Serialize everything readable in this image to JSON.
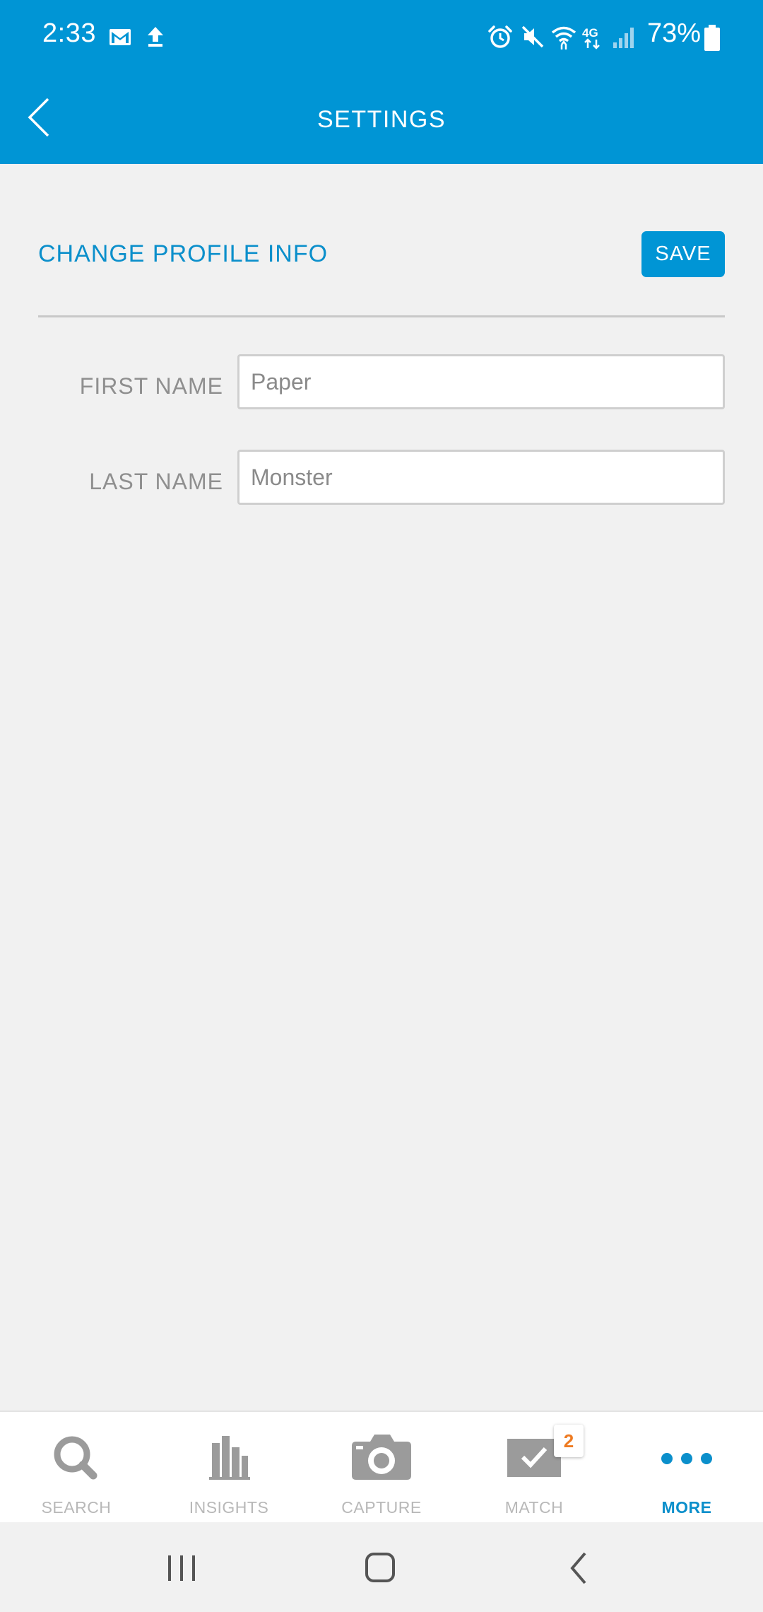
{
  "status_bar": {
    "time": "2:33",
    "battery_percent": "73%",
    "icons": [
      "gmail-icon",
      "upload-icon",
      "alarm-icon",
      "mute-icon",
      "wifi-icon",
      "4g-lte-icon",
      "signal-icon",
      "battery-icon"
    ]
  },
  "header": {
    "title": "SETTINGS",
    "back_icon": "chevron-left-icon"
  },
  "profile": {
    "section_title": "CHANGE PROFILE INFO",
    "save_label": "SAVE",
    "first_name_label": "FIRST NAME",
    "first_name_value": "Paper",
    "last_name_label": "LAST NAME",
    "last_name_value": "Monster"
  },
  "bottom_nav": {
    "tabs": [
      {
        "label": "SEARCH",
        "icon": "search-icon",
        "active": false
      },
      {
        "label": "INSIGHTS",
        "icon": "bar-chart-icon",
        "active": false
      },
      {
        "label": "CAPTURE",
        "icon": "camera-icon",
        "active": false
      },
      {
        "label": "MATCH",
        "icon": "check-box-icon",
        "active": false,
        "badge": "2"
      },
      {
        "label": "MORE",
        "icon": "more-dots-icon",
        "active": true
      }
    ]
  },
  "system_nav": {
    "buttons": [
      "recents-icon",
      "home-icon",
      "back-icon"
    ]
  },
  "colors": {
    "brand_blue": "#0095d5",
    "accent_text_blue": "#0b8fcb",
    "inactive_gray": "#b8b8b8",
    "badge_orange": "#ee7b22",
    "background": "#f1f1f1"
  }
}
